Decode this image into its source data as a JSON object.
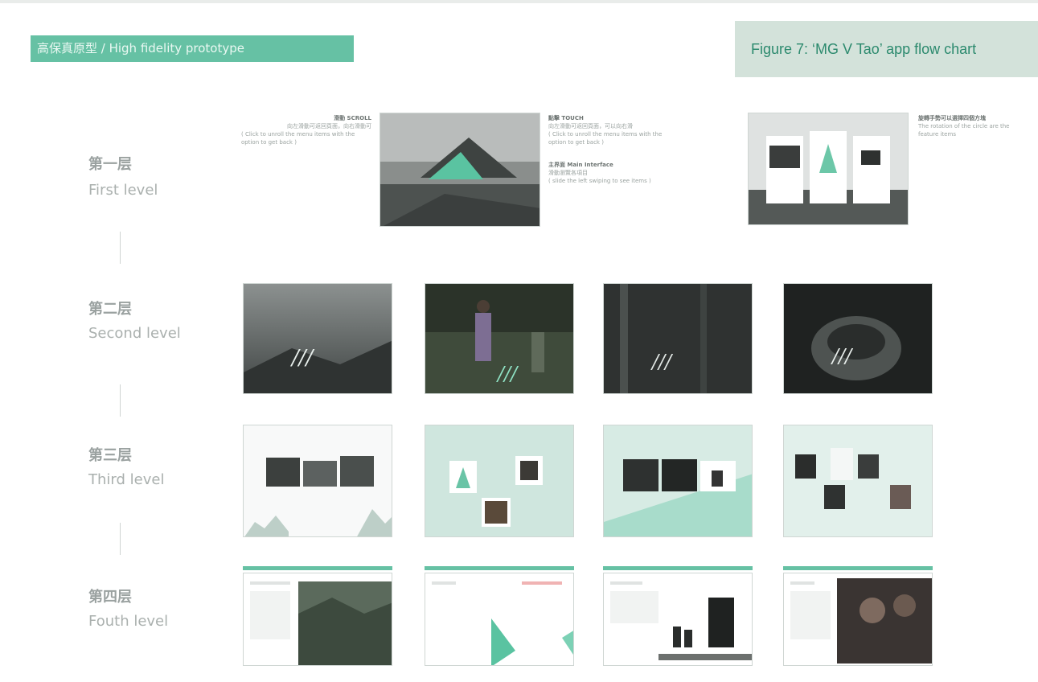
{
  "header": {
    "tag_label": "高保真原型 / High fidelity prototype",
    "figure_caption": "Figure 7: ‘MG V Tao’ app flow chart"
  },
  "levels": [
    {
      "cn": "第一层",
      "en": "First level"
    },
    {
      "cn": "第二层",
      "en": "Second level"
    },
    {
      "cn": "第三层",
      "en": "Third level"
    },
    {
      "cn": "第四层",
      "en": "Fouth level"
    }
  ],
  "notes": {
    "n1_title": "滑動 SCROLL",
    "n1_cn": "向左滑動可返回頁面，向右滑動可",
    "n1_en": "( Click to unroll the menu items with the option to get back )",
    "n2_title": "點擊 TOUCH",
    "n2_cn": "向左滑動可返回頁面，可以向右滑",
    "n2_en": "( Click to unroll the menu items with the option to get back )",
    "n3_title": "主界面 Main Interface",
    "n3_cn": "滑動瀏覽各項目",
    "n3_en": "( slide the left swiping to see items )",
    "n4_title": "旋轉手勢可以選擇四個方塊",
    "n4_en": "The rotation of the circle are the feature items"
  },
  "colors": {
    "accent": "#66c1a4",
    "caption_bg": "#d3e2da",
    "caption_text": "#2c8a6e",
    "level_text": "#9aa1a0"
  }
}
